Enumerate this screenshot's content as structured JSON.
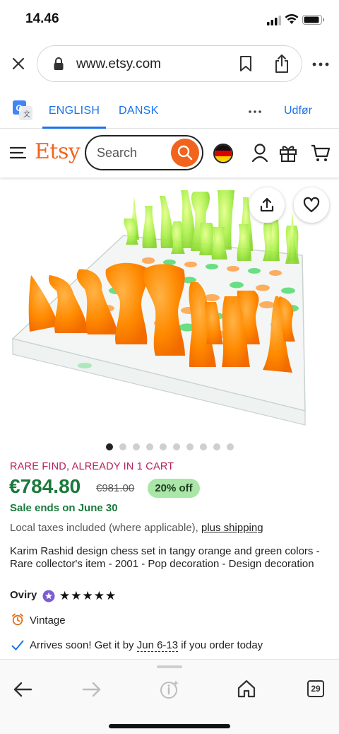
{
  "status_bar": {
    "time": "14.46"
  },
  "browser": {
    "url": "www.etsy.com",
    "translate": {
      "lang_source": "ENGLISH",
      "lang_target": "DANSK",
      "action": "Udfør"
    },
    "toolbar": {
      "tab_count": "29"
    }
  },
  "etsy_header": {
    "logo": "Etsy",
    "search_placeholder": "Search",
    "accent_color": "#f1641e"
  },
  "gallery": {
    "image_count": 10,
    "active_index": 0
  },
  "product": {
    "badge": "RARE FIND, ALREADY IN 1 CART",
    "price": "€784.80",
    "original_price": "€981.00",
    "discount": "20% off",
    "sale_ends": "Sale ends on June 30",
    "taxes_text": "Local taxes included (where applicable),",
    "shipping_link": "plus shipping",
    "title": "Karim Rashid design chess set in tangy orange and green colors - Rare collector's item - 2001 - Pop decoration - Design decoration",
    "shop_name": "Oviry",
    "rating_stars": "★★★★★",
    "rating": 5,
    "tag": "Vintage",
    "arrival_prefix": "Arrives soon! Get it by",
    "arrival_dates": "Jun 6-13",
    "arrival_suffix": "if you order today"
  },
  "colors": {
    "price_green": "#1a7a3c",
    "rare_pink": "#b4205a",
    "discount_bg": "#a9e6a7",
    "link_blue": "#1a73e8"
  }
}
